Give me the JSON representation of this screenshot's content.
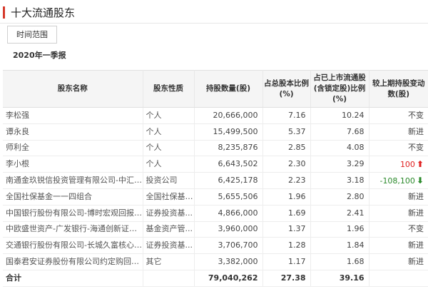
{
  "header": {
    "title": "十大流通股东"
  },
  "filter": {
    "range_label": "时间范围"
  },
  "period": {
    "label": "2020年一季报"
  },
  "table": {
    "headers": [
      "股东名称",
      "股东性质",
      "持股数量(股)",
      "占总股本比例(%)",
      "占已上市流通股(含锁定股)比例(%)",
      "较上期持股变动数(股)"
    ],
    "rows": [
      {
        "name": "李松强",
        "type": "个人",
        "shares": "20,666,000",
        "pct_total": "7.16",
        "pct_float": "10.24",
        "change": "不变",
        "dir": ""
      },
      {
        "name": "谭永良",
        "type": "个人",
        "shares": "15,499,500",
        "pct_total": "5.37",
        "pct_float": "7.68",
        "change": "新进",
        "dir": ""
      },
      {
        "name": "师利全",
        "type": "个人",
        "shares": "8,235,876",
        "pct_total": "2.85",
        "pct_float": "4.08",
        "change": "不变",
        "dir": ""
      },
      {
        "name": "李小根",
        "type": "个人",
        "shares": "6,643,502",
        "pct_total": "2.30",
        "pct_float": "3.29",
        "change": "100",
        "dir": "up"
      },
      {
        "name": "南通金玖锐信投资管理有限公司-中汇金...",
        "type": "投资公司",
        "shares": "6,425,178",
        "pct_total": "2.23",
        "pct_float": "3.18",
        "change": "-108,100",
        "dir": "down"
      },
      {
        "name": "全国社保基金一一四组合",
        "type": "全国社保基金...",
        "shares": "5,655,506",
        "pct_total": "1.96",
        "pct_float": "2.80",
        "change": "新进",
        "dir": ""
      },
      {
        "name": "中国银行股份有限公司-博时宏观回报债...",
        "type": "证券投资基...",
        "shares": "4,866,000",
        "pct_total": "1.69",
        "pct_float": "2.41",
        "change": "新进",
        "dir": ""
      },
      {
        "name": "中欧盛世资产-广发银行-海通创新证券...",
        "type": "基金资产管...",
        "shares": "3,960,000",
        "pct_total": "1.37",
        "pct_float": "1.96",
        "change": "不变",
        "dir": ""
      },
      {
        "name": "交通银行股份有限公司-长城久富核心成...",
        "type": "证券投资基...",
        "shares": "3,706,700",
        "pct_total": "1.28",
        "pct_float": "1.84",
        "change": "新进",
        "dir": ""
      },
      {
        "name": "国泰君安证券股份有限公司约定购回专...",
        "type": "其它",
        "shares": "3,382,000",
        "pct_total": "1.17",
        "pct_float": "1.68",
        "change": "新进",
        "dir": ""
      }
    ],
    "total": {
      "label": "合计",
      "shares": "79,040,262",
      "pct_total": "27.38",
      "pct_float": "39.16"
    }
  },
  "colors": {
    "accent": "#d6392b",
    "up": "#e02020",
    "down": "#2b8a2b"
  }
}
